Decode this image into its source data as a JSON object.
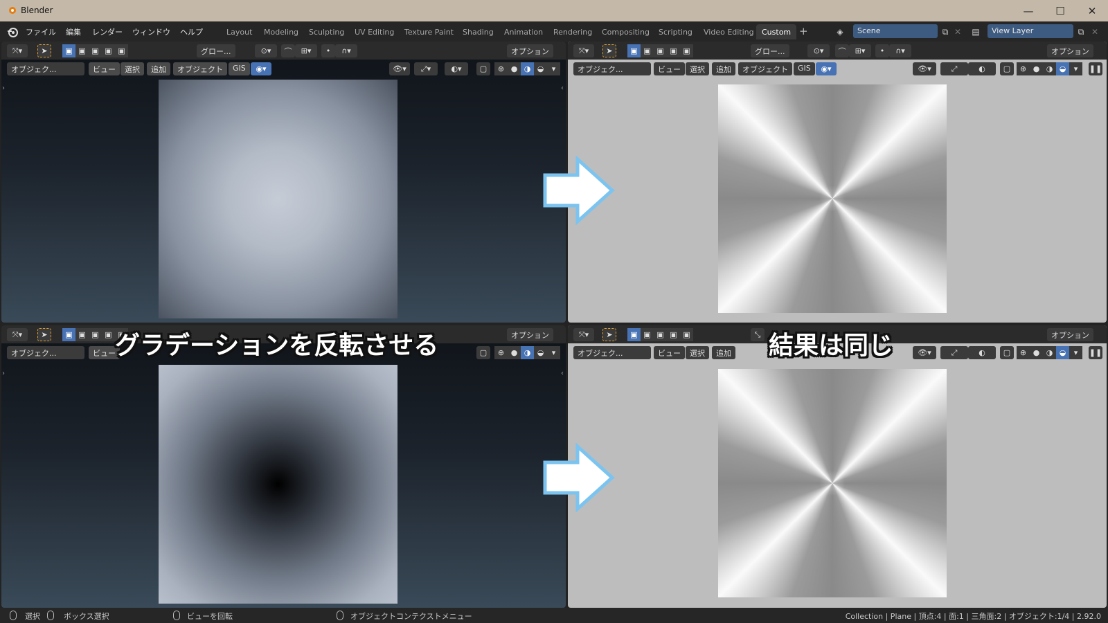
{
  "window": {
    "title": "Blender",
    "minimize": "—",
    "maximize": "☐",
    "close": "✕"
  },
  "menu": [
    "ファイル",
    "編集",
    "レンダー",
    "ウィンドウ",
    "ヘルプ"
  ],
  "workspaces": [
    "Layout",
    "Modeling",
    "Sculpting",
    "UV Editing",
    "Texture Paint",
    "Shading",
    "Animation",
    "Rendering",
    "Compositing",
    "Scripting",
    "Video Editing",
    "Custom"
  ],
  "active_workspace": "Custom",
  "add_workspace": "+",
  "scene": {
    "label": "Scene"
  },
  "view_layer": {
    "label": "View Layer"
  },
  "viewport": {
    "transform_orientation": "グロー...",
    "options": "オプション",
    "mode": "オブジェク...",
    "menus": [
      "ビュー",
      "選択",
      "追加",
      "オブジェクト",
      "GIS"
    ]
  },
  "overlays": {
    "left_caption": "グラデーションを反転させる",
    "right_caption": "結果は同じ"
  },
  "status": {
    "select": "選択",
    "box_select": "ボックス選択",
    "rotate_view": "ビューを回転",
    "context_menu": "オブジェクトコンテクストメニュー",
    "stats": "Collection | Plane | 頂点:4 | 面:1 | 三角面:2 | オブジェクト:1/4 | 2.92.0"
  },
  "colors": {
    "accent": "#4772b3",
    "arrow_fill": "#ffffff",
    "arrow_stroke": "#7cc4f0"
  }
}
